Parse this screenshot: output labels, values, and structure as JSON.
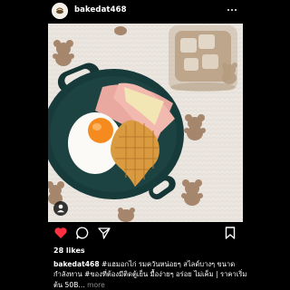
{
  "header": {
    "username": "bakedat468"
  },
  "post": {
    "likes_text": "28 likes",
    "caption_user": "bakedat468",
    "caption_text": " #แฮมอกไก่ รมควันหน่อยๆ สไลด์บางๆ ขนาดกำลังทาน #ของที่ต้องมีติดตู้เย็น มื้อง่ายๆ อร่อย ไม่เค็ม | ราคาเริ่มต้น 50B...",
    "more_label": " more"
  },
  "icons": {
    "like": "heart-icon",
    "comment": "comment-icon",
    "share": "send-icon",
    "save": "bookmark-icon",
    "tag": "person-tag-icon",
    "menu": "more-icon"
  },
  "colors": {
    "background": "#000000",
    "like_red": "#ff3040",
    "text_secondary": "#8e8e8e"
  }
}
